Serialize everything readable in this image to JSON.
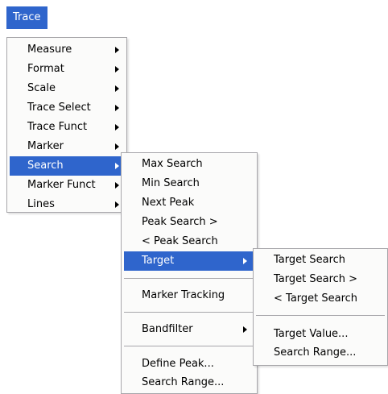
{
  "menubar": {
    "trace_label": "Trace"
  },
  "menu1": {
    "items": [
      {
        "label": "Measure"
      },
      {
        "label": "Format"
      },
      {
        "label": "Scale"
      },
      {
        "label": "Trace Select"
      },
      {
        "label": "Trace Funct"
      },
      {
        "label": "Marker"
      },
      {
        "label": "Search",
        "highlighted": true
      },
      {
        "label": "Marker Funct"
      },
      {
        "label": "Lines"
      }
    ]
  },
  "menu2": {
    "items": [
      {
        "label": "Max Search"
      },
      {
        "label": "Min Search"
      },
      {
        "label": "Next Peak"
      },
      {
        "label": "Peak Search >"
      },
      {
        "label": "< Peak Search"
      },
      {
        "label": "Target",
        "highlighted": true
      },
      {
        "label": "Marker Tracking"
      },
      {
        "label": "Bandfilter"
      },
      {
        "label": "Define Peak..."
      },
      {
        "label": "Search Range..."
      }
    ]
  },
  "menu3": {
    "items": [
      {
        "label": "Target Search"
      },
      {
        "label": "Target Search >"
      },
      {
        "label": "< Target Search"
      },
      {
        "label": "Target Value..."
      },
      {
        "label": "Search Range..."
      }
    ]
  },
  "colors": {
    "highlight": "#2f65cc",
    "menu_bg": "#fbfbfa",
    "border": "#a7a6aa"
  }
}
